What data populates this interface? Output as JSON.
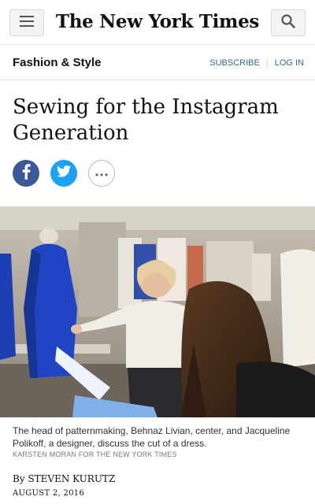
{
  "header": {
    "logo": "The New York Times",
    "menu_icon": "hamburger-menu-icon",
    "search_icon": "search-icon"
  },
  "section": {
    "name": "Fashion & Style",
    "subscribe": "SUBSCRIBE",
    "login": "LOG IN",
    "link_color": "#326891"
  },
  "article": {
    "headline": "Sewing for the Instagram Generation",
    "share": [
      {
        "network": "facebook",
        "icon": "facebook-icon",
        "color": "#3b5998"
      },
      {
        "network": "twitter",
        "icon": "twitter-icon",
        "color": "#1da1f2"
      },
      {
        "network": "more",
        "icon": "more-icon"
      }
    ],
    "caption": "The head of patternmaking, Behnaz Livian, center, and Jacqueline Polikoff, a designer, discuss the cut of a dress.",
    "credit": "KARSTEN MORAN FOR THE NEW YORK TIMES",
    "byline": "By STEVEN KURUTZ",
    "date": "AUGUST 2, 2016"
  }
}
